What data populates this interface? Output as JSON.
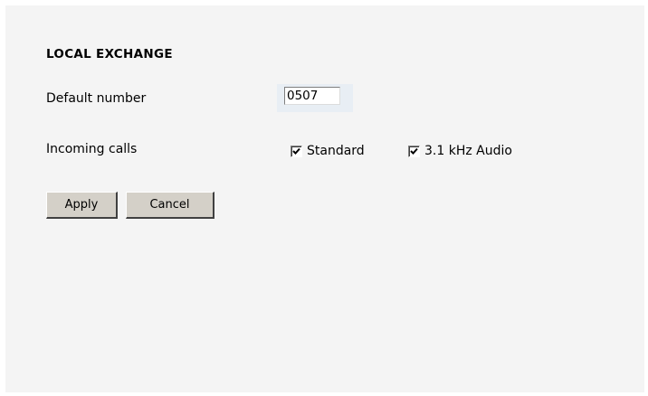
{
  "section": {
    "title": "LOCAL EXCHANGE"
  },
  "default_number": {
    "label": "Default number",
    "value": "0507"
  },
  "incoming_calls": {
    "label": "Incoming calls",
    "options": [
      {
        "label": "Standard",
        "checked": true
      },
      {
        "label": "3.1 kHz Audio",
        "checked": true
      }
    ]
  },
  "actions": {
    "apply_label": "Apply",
    "cancel_label": "Cancel"
  },
  "colors": {
    "panel_background": "#f4f4f4",
    "button_face": "#d4d0c8"
  }
}
